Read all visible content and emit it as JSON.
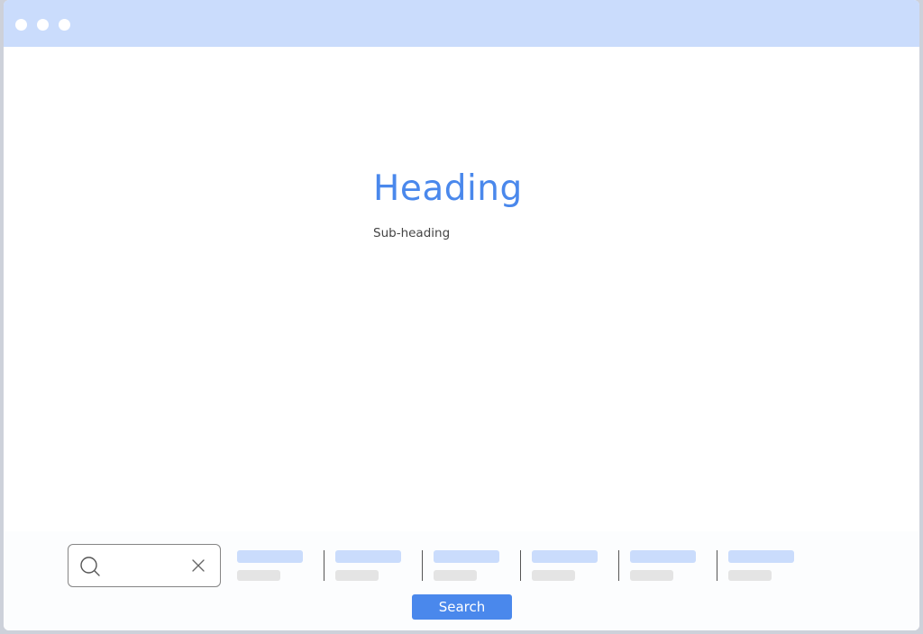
{
  "window": {
    "titlebar_color": "#cadcfc",
    "controls": [
      "window-dot",
      "window-dot",
      "window-dot"
    ]
  },
  "hero": {
    "heading": "Heading",
    "subheading": "Sub-heading"
  },
  "search": {
    "value": "",
    "placeholder": "",
    "search_icon": "search-icon",
    "clear_icon": "close-icon",
    "button_label": "Search"
  },
  "filters": {
    "count": 6,
    "placeholder_top_color": "#cadcfc",
    "placeholder_bottom_color": "#e4e4e4"
  },
  "colors": {
    "accent": "#4a88ec",
    "text": "#444444"
  }
}
